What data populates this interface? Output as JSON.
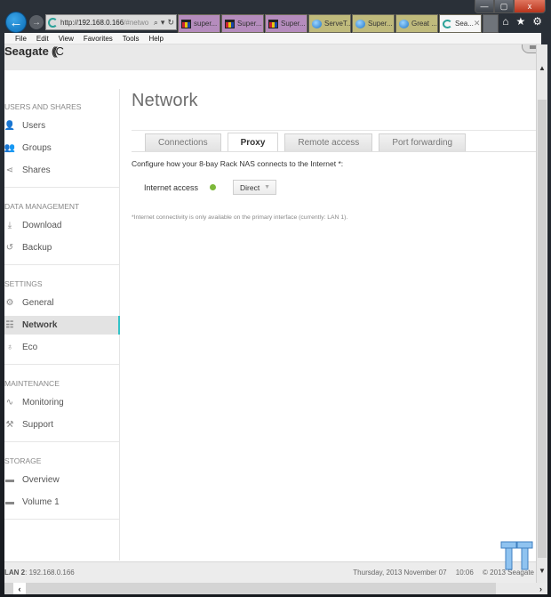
{
  "browser": {
    "address": {
      "scheme": "http://",
      "host": "192.168.0.166",
      "rest": "/#netwo"
    },
    "tabs": [
      {
        "label": "super...",
        "style": "purple",
        "icon": "shopping-bag-icon"
      },
      {
        "label": "Super...",
        "style": "purple",
        "icon": "shopping-bag-icon"
      },
      {
        "label": "Super...",
        "style": "purple",
        "icon": "shopping-bag-icon"
      },
      {
        "label": "ServeT...",
        "style": "olive",
        "icon": "globe-icon"
      },
      {
        "label": "Super...",
        "style": "olive",
        "icon": "globe-icon"
      },
      {
        "label": "Great ...",
        "style": "olive",
        "icon": "globe-icon"
      },
      {
        "label": "Sea...",
        "style": "active",
        "icon": "seagate-icon"
      }
    ],
    "menu": [
      "File",
      "Edit",
      "View",
      "Favorites",
      "Tools",
      "Help"
    ],
    "window_controls": {
      "minimize": "—",
      "maximize": "▢",
      "close": "x"
    }
  },
  "app": {
    "logo": "Seagate",
    "sidebar": [
      {
        "title": "Users and Shares",
        "items": [
          {
            "label": "Users",
            "icon": "user-icon"
          },
          {
            "label": "Groups",
            "icon": "groups-icon"
          },
          {
            "label": "Shares",
            "icon": "share-icon"
          }
        ]
      },
      {
        "title": "Data Management",
        "items": [
          {
            "label": "Download",
            "icon": "download-icon"
          },
          {
            "label": "Backup",
            "icon": "backup-icon"
          }
        ]
      },
      {
        "title": "Settings",
        "items": [
          {
            "label": "General",
            "icon": "gear-icon"
          },
          {
            "label": "Network",
            "icon": "network-icon",
            "active": true
          },
          {
            "label": "Eco",
            "icon": "eco-bulb-icon"
          }
        ]
      },
      {
        "title": "Maintenance",
        "items": [
          {
            "label": "Monitoring",
            "icon": "pulse-icon"
          },
          {
            "label": "Support",
            "icon": "wrench-icon"
          }
        ]
      },
      {
        "title": "Storage",
        "items": [
          {
            "label": "Overview",
            "icon": "disk-icon"
          },
          {
            "label": "Volume 1",
            "icon": "disk-icon"
          }
        ]
      }
    ],
    "page_title": "Network",
    "tabs": [
      {
        "label": "Connections",
        "active": false
      },
      {
        "label": "Proxy",
        "active": true
      },
      {
        "label": "Remote access",
        "active": false
      },
      {
        "label": "Port forwarding",
        "active": false
      }
    ],
    "intro": "Configure how your 8-bay Rack NAS connects to the Internet *:",
    "internet_access": {
      "label": "Internet access",
      "status_color": "#7db83a",
      "value": "Direct"
    },
    "footnote": "*Internet connectivity is only available on the primary interface (currently: LAN 1).",
    "status": {
      "lan_label": "LAN 2",
      "lan_ip": ": 192.168.0.166",
      "date": "Thursday, 2013 November 07",
      "time": "10:06",
      "copyright": "© 2013 Seagate"
    },
    "accent_color": "#33c3c8"
  }
}
